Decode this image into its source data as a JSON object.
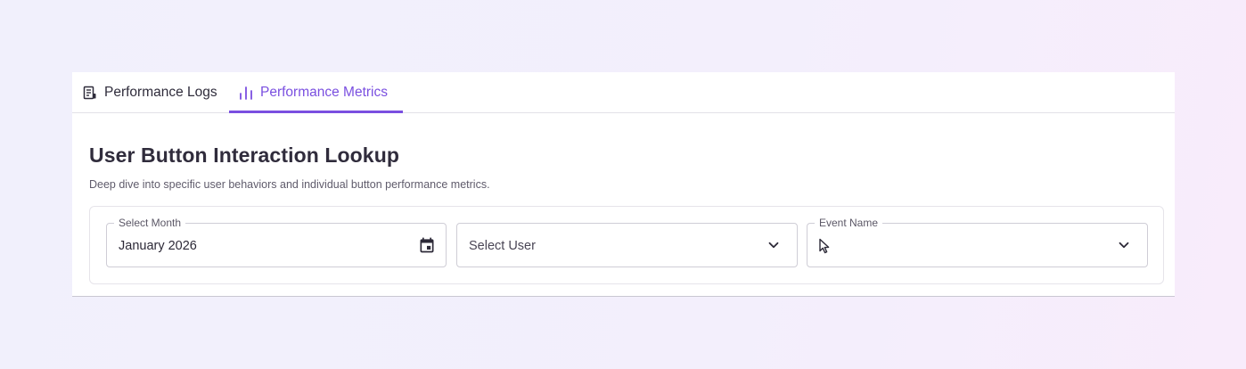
{
  "tabs": {
    "logs": {
      "label": "Performance Logs",
      "icon": "document-list-icon"
    },
    "metrics": {
      "label": "Performance Metrics",
      "icon": "bar-chart-icon",
      "active": true
    }
  },
  "section": {
    "title": "User Button Interaction Lookup",
    "description": "Deep dive into specific user behaviors and individual button performance metrics."
  },
  "filters": {
    "month": {
      "label": "Select Month",
      "value": "January 2026",
      "icon": "calendar-icon"
    },
    "user": {
      "placeholder": "Select User",
      "icon": "chevron-down-icon"
    },
    "event": {
      "label": "Event Name",
      "value": "",
      "icon": "chevron-down-icon"
    }
  },
  "colors": {
    "accent": "#7a4fe0",
    "text": "#2e2b3a",
    "muted": "#5f5b6b"
  }
}
